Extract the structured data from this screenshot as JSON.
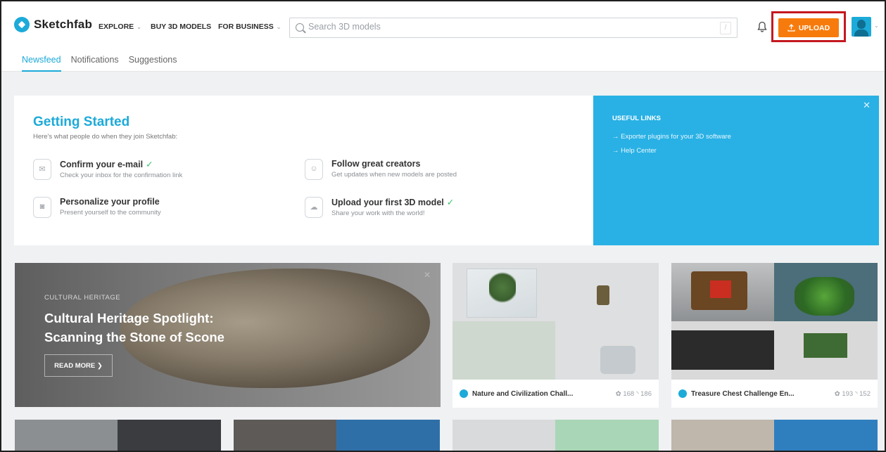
{
  "header": {
    "logo_text": "Sketchfab",
    "nav": [
      {
        "label": "EXPLORE",
        "has_dropdown": true
      },
      {
        "label": "BUY 3D MODELS",
        "has_dropdown": false
      },
      {
        "label": "FOR BUSINESS",
        "has_dropdown": true
      }
    ],
    "search_placeholder": "Search 3D models",
    "search_shortcut": "/",
    "upload_label": "UPLOAD",
    "brand_color": "#1caad9",
    "upload_color": "#f77b0c",
    "highlight_color": "#c41820"
  },
  "tabs": [
    {
      "label": "Newsfeed",
      "active": true
    },
    {
      "label": "Notifications",
      "active": false
    },
    {
      "label": "Suggestions",
      "active": false
    }
  ],
  "getting_started": {
    "title": "Getting Started",
    "subtitle": "Here's what people do when they join Sketchfab:",
    "steps": [
      {
        "title": "Confirm your e-mail",
        "desc": "Check your inbox for the confirmation link",
        "done": true,
        "icon": "envelope-icon"
      },
      {
        "title": "Follow great creators",
        "desc": "Get updates when new models are posted",
        "done": false,
        "icon": "user-icon"
      },
      {
        "title": "Personalize your profile",
        "desc": "Present yourself to the community",
        "done": false,
        "icon": "camera-icon"
      },
      {
        "title": "Upload your first 3D model",
        "desc": "Share your work with the world!",
        "done": true,
        "icon": "cloud-upload-icon"
      }
    ],
    "useful_links": {
      "title": "USEFUL LINKS",
      "items": [
        "→ Exporter plugins for your 3D software",
        "→ Help Center"
      ]
    }
  },
  "feature": {
    "category": "CULTURAL HERITAGE",
    "title": "Cultural Heritage Spotlight: Scanning the Stone of Scone",
    "cta": "READ MORE ❯"
  },
  "cards": [
    {
      "title": "Nature and Civilization Chall...",
      "views": "168",
      "comments": "186"
    },
    {
      "title": "Treasure Chest Challenge En...",
      "views": "193",
      "comments": "152"
    }
  ]
}
